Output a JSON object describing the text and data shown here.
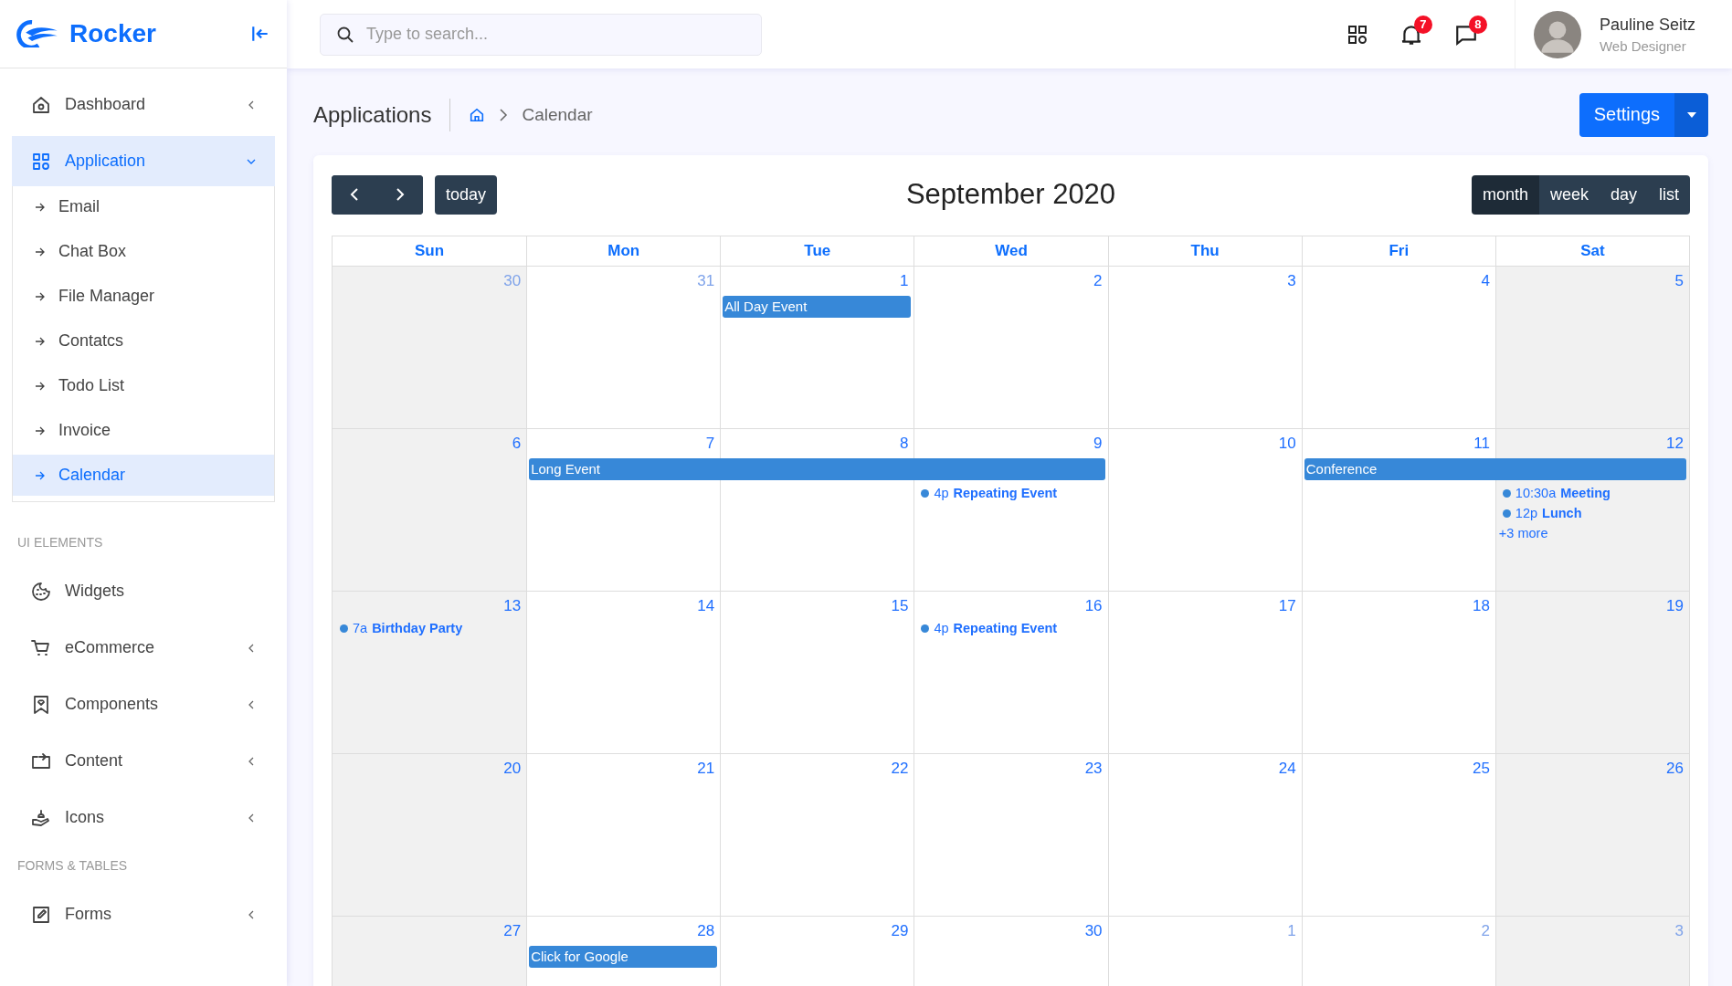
{
  "brand": {
    "name": "Rocker"
  },
  "sidebar": {
    "sections": [
      {
        "items": [
          {
            "label": "Dashboard",
            "expanded": false,
            "selected": false
          },
          {
            "label": "Application",
            "expanded": true,
            "selected": true,
            "children": [
              {
                "label": "Email",
                "selected": false
              },
              {
                "label": "Chat Box",
                "selected": false
              },
              {
                "label": "File Manager",
                "selected": false
              },
              {
                "label": "Contatcs",
                "selected": false
              },
              {
                "label": "Todo List",
                "selected": false
              },
              {
                "label": "Invoice",
                "selected": false
              },
              {
                "label": "Calendar",
                "selected": true
              }
            ]
          }
        ]
      },
      {
        "label": "UI ELEMENTS",
        "items": [
          {
            "label": "Widgets",
            "selected": false
          },
          {
            "label": "eCommerce",
            "expanded": false,
            "selected": false
          },
          {
            "label": "Components",
            "expanded": false,
            "selected": false
          },
          {
            "label": "Content",
            "expanded": false,
            "selected": false
          },
          {
            "label": "Icons",
            "expanded": false,
            "selected": false
          }
        ]
      },
      {
        "label": "FORMS & TABLES",
        "items": [
          {
            "label": "Forms",
            "expanded": false,
            "selected": false
          }
        ]
      }
    ]
  },
  "search": {
    "placeholder": "Type to search..."
  },
  "notifications": {
    "alerts": "7",
    "messages": "8"
  },
  "user": {
    "name": "Pauline Seitz",
    "role": "Web Designer"
  },
  "page": {
    "title": "Applications",
    "breadcrumb": "Calendar",
    "action": "Settings"
  },
  "calendar": {
    "title": "September 2020",
    "today": "today",
    "views": [
      {
        "label": "month",
        "selected": true
      },
      {
        "label": "week",
        "selected": false
      },
      {
        "label": "day",
        "selected": false
      },
      {
        "label": "list",
        "selected": false
      }
    ],
    "weekdays": [
      "Sun",
      "Mon",
      "Tue",
      "Wed",
      "Thu",
      "Fri",
      "Sat"
    ],
    "weeks": [
      {
        "days": [
          {
            "number": "30",
            "other_month": true
          },
          {
            "number": "31",
            "other_month": true
          },
          {
            "number": "1",
            "other_month": false,
            "bar": {
              "title": "All Day Event",
              "first": true
            }
          },
          {
            "number": "2",
            "other_month": false
          },
          {
            "number": "3",
            "other_month": false
          },
          {
            "number": "4",
            "other_month": false
          },
          {
            "number": "5",
            "other_month": false
          }
        ]
      },
      {
        "days": [
          {
            "number": "6",
            "other_month": false
          },
          {
            "number": "7",
            "other_month": false,
            "bar": {
              "title": "Long Event",
              "first": true
            }
          },
          {
            "number": "8",
            "other_month": false,
            "bar": {
              "first": false
            }
          },
          {
            "number": "9",
            "other_month": false,
            "bar": {
              "first": false
            },
            "events": [
              {
                "time": "4p",
                "title": "Repeating Event"
              }
            ]
          },
          {
            "number": "10",
            "other_month": false
          },
          {
            "number": "11",
            "other_month": false,
            "bar": {
              "title": "Conference",
              "first": true
            }
          },
          {
            "number": "12",
            "other_month": false,
            "bar": {
              "first": false
            },
            "events": [
              {
                "time": "10:30a",
                "title": "Meeting"
              },
              {
                "time": "12p",
                "title": "Lunch"
              }
            ],
            "more": "+3 more"
          }
        ]
      },
      {
        "days": [
          {
            "number": "13",
            "other_month": false,
            "events": [
              {
                "time": "7a",
                "title": "Birthday Party"
              }
            ]
          },
          {
            "number": "14",
            "other_month": false
          },
          {
            "number": "15",
            "other_month": false
          },
          {
            "number": "16",
            "other_month": false,
            "events": [
              {
                "time": "4p",
                "title": "Repeating Event"
              }
            ]
          },
          {
            "number": "17",
            "other_month": false
          },
          {
            "number": "18",
            "other_month": false
          },
          {
            "number": "19",
            "other_month": false
          }
        ]
      },
      {
        "days": [
          {
            "number": "20",
            "other_month": false
          },
          {
            "number": "21",
            "other_month": false
          },
          {
            "number": "22",
            "other_month": false
          },
          {
            "number": "23",
            "other_month": false
          },
          {
            "number": "24",
            "other_month": false
          },
          {
            "number": "25",
            "other_month": false
          },
          {
            "number": "26",
            "other_month": false
          }
        ]
      },
      {
        "days": [
          {
            "number": "27",
            "other_month": false
          },
          {
            "number": "28",
            "other_month": false,
            "bar": {
              "title": "Click for Google",
              "first": true
            }
          },
          {
            "number": "29",
            "other_month": false
          },
          {
            "number": "30",
            "other_month": false
          },
          {
            "number": "1",
            "other_month": true
          },
          {
            "number": "2",
            "other_month": true
          },
          {
            "number": "3",
            "other_month": true
          }
        ]
      }
    ]
  }
}
